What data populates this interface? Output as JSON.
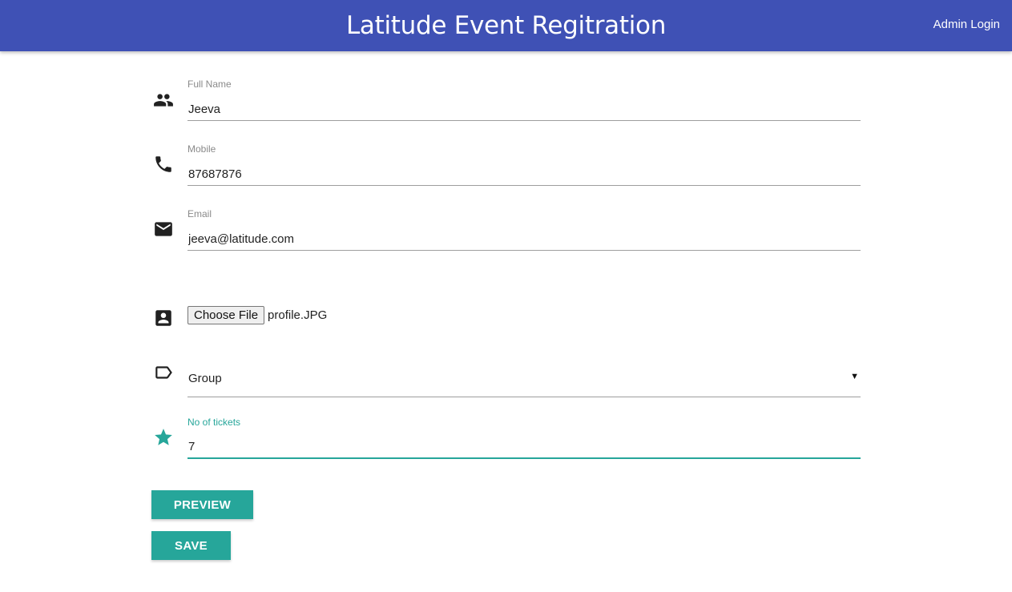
{
  "header": {
    "title": "Latitude Event Regitration",
    "admin_login": "Admin Login"
  },
  "form": {
    "full_name": {
      "label": "Full Name",
      "value": "Jeeva",
      "icon": "people-icon"
    },
    "mobile": {
      "label": "Mobile",
      "value": "87687876",
      "icon": "phone-icon"
    },
    "email": {
      "label": "Email",
      "value": "jeeva@latitude.com",
      "icon": "email-icon"
    },
    "photo": {
      "button_label": "Choose File",
      "file_name": "profile.JPG",
      "icon": "id-card-icon"
    },
    "group": {
      "value": "Group",
      "arrow": "▼",
      "icon": "label-icon"
    },
    "tickets": {
      "label": "No of tickets",
      "value": "7",
      "icon": "star-icon"
    }
  },
  "buttons": {
    "preview": "PREVIEW",
    "save": "SAVE"
  },
  "colors": {
    "header": "#3f51b5",
    "accent": "#26a69a",
    "icon": "#212121"
  }
}
